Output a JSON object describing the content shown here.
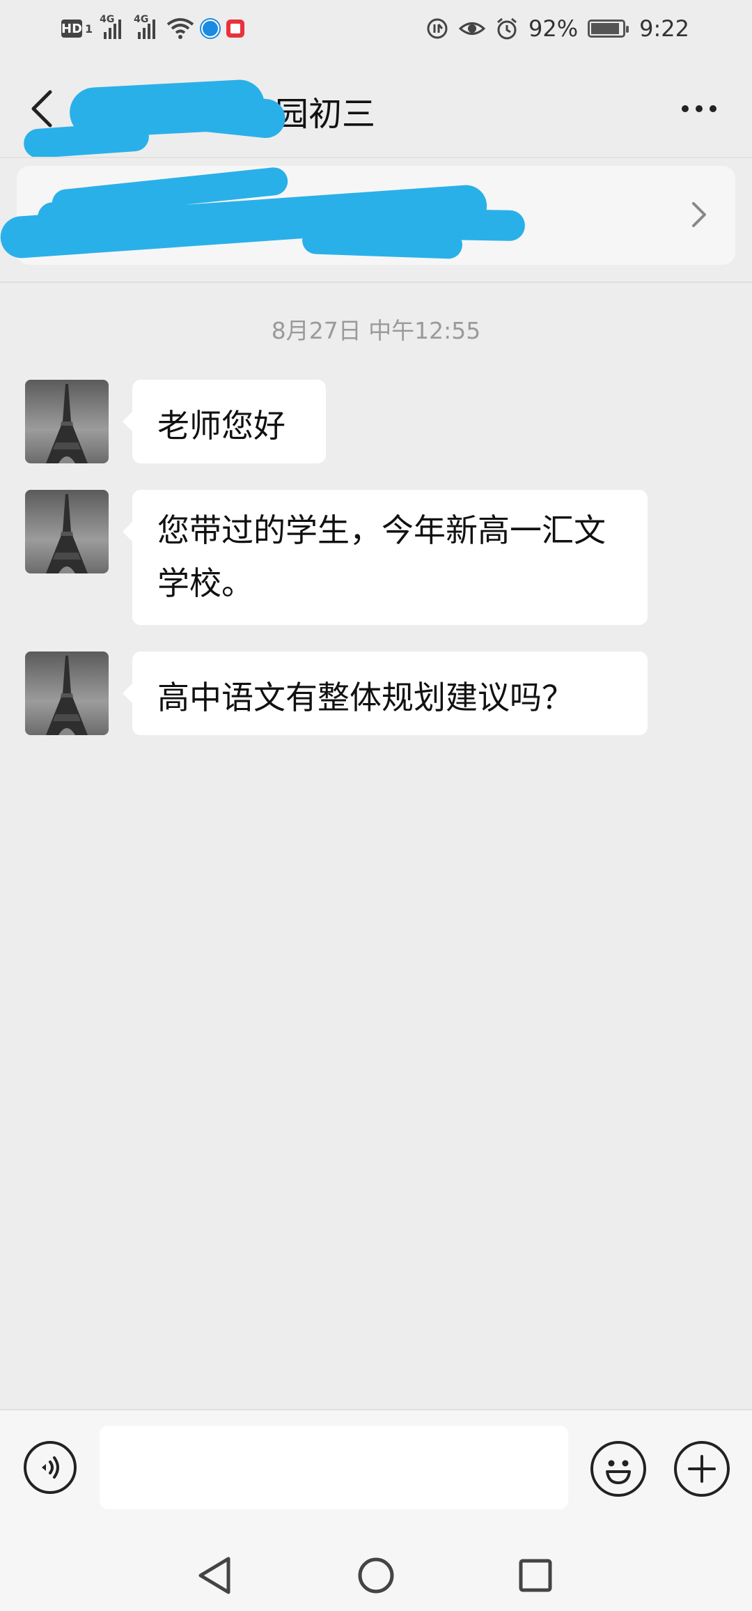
{
  "status_bar": {
    "hd_label": "HD",
    "sim_label": "1",
    "network_1": "4G",
    "network_2": "4G",
    "battery_percent_text": "92%",
    "battery_level": 0.92,
    "time": "9:22",
    "icons": [
      "hd-icon",
      "signal-icon",
      "signal-icon",
      "wifi-icon",
      "app-notification-icon",
      "app-notification-icon",
      "data-saver-icon",
      "eye-comfort-icon",
      "alarm-icon",
      "battery-icon"
    ]
  },
  "header": {
    "title": "园初三",
    "back_icon": "chevron-left-icon",
    "more_icon": "more-dots-icon"
  },
  "notice": {
    "chevron_icon": "chevron-right-icon"
  },
  "chat": {
    "timestamp": "8月27日 中午12:55",
    "messages": [
      {
        "text": "老师您好"
      },
      {
        "text": "您带过的学生，今年新高一汇文学校。"
      },
      {
        "text": "高中语文有整体规划建议吗？"
      }
    ]
  },
  "input_bar": {
    "voice_icon": "voice-icon",
    "emoji_icon": "emoji-icon",
    "plus_icon": "plus-icon",
    "input_value": ""
  },
  "nav": {
    "icons": [
      "back-triangle-icon",
      "home-circle-icon",
      "recents-square-icon"
    ]
  },
  "colors": {
    "background": "#ededed",
    "bubble": "#ffffff",
    "redaction": "#2ab0e8",
    "timestamp": "#9a9a9a"
  }
}
